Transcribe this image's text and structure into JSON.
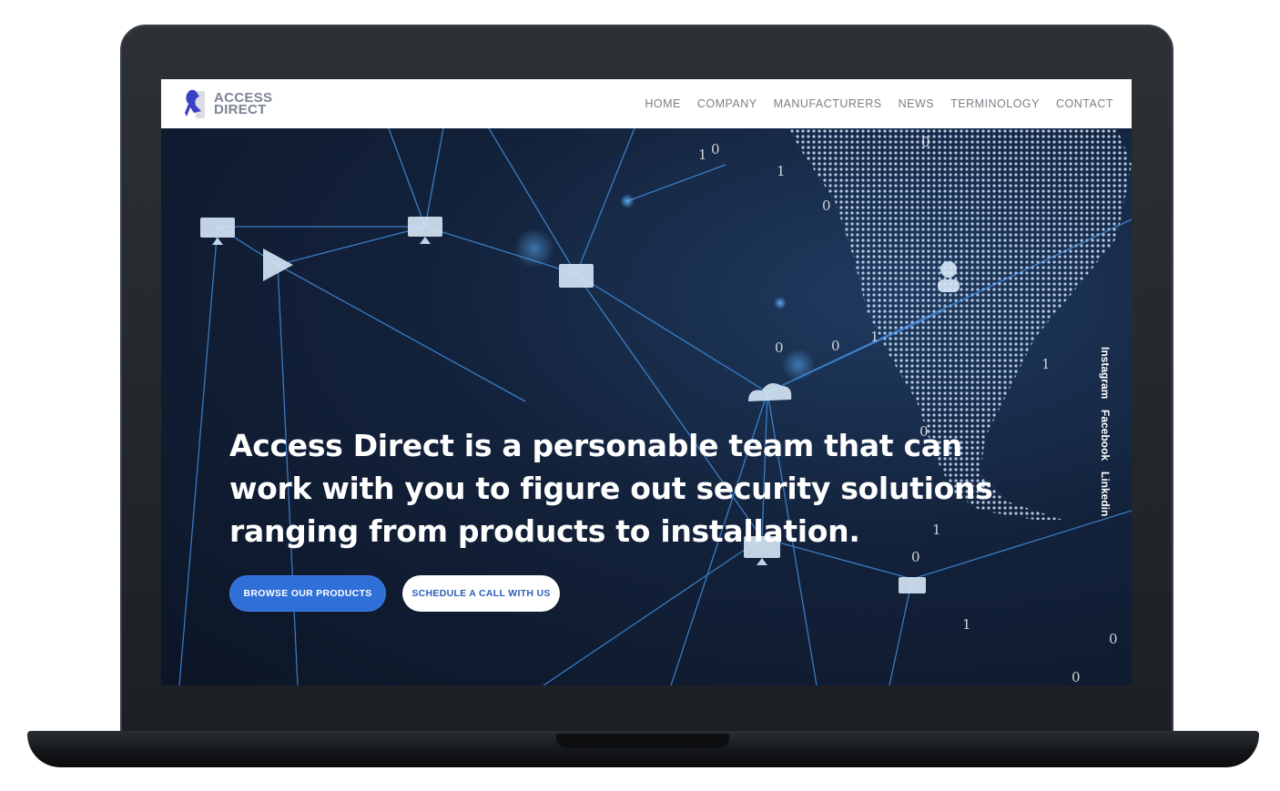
{
  "site": {
    "logo_line1": "ACCESS",
    "logo_line2": "DIRECT"
  },
  "nav": {
    "items": [
      "HOME",
      "COMPANY",
      "MANUFACTURERS",
      "NEWS",
      "TERMINOLOGY",
      "CONTACT"
    ]
  },
  "hero": {
    "headline": "Access Direct is a personable team that can work with you to figure out security solutions ranging from products to installation.",
    "primary_button": "BROWSE OUR PRODUCTS",
    "secondary_button": "SCHEDULE A CALL WITH US",
    "binary_digits": [
      "1",
      "0",
      "0",
      "1",
      "0",
      "0",
      "0",
      "1",
      "1",
      "0",
      "1",
      "0",
      "0",
      "1",
      "0"
    ]
  },
  "social": {
    "instagram": "Instagram",
    "facebook": "Facebook",
    "linkedin": "Linkedin"
  },
  "colors": {
    "accent": "#2f6fd8",
    "nav_text": "#7a7f87",
    "hero_bg": "#13223b",
    "logo_blue": "#3b3fc4"
  }
}
